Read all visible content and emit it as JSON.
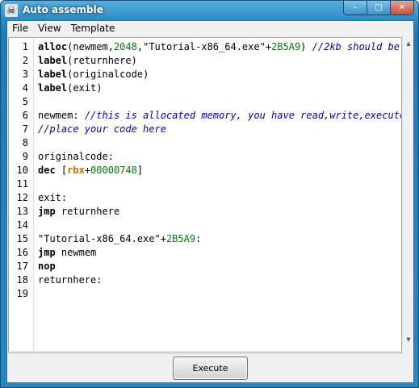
{
  "window": {
    "title": "Auto assemble",
    "icon_glyph": "☠",
    "caption_buttons": {
      "minimize": "–",
      "maximize": "□",
      "close": "✕"
    }
  },
  "menu": {
    "items": [
      {
        "label": "File"
      },
      {
        "label": "View"
      },
      {
        "label": "Template"
      }
    ]
  },
  "editor": {
    "line_numbers": [
      "1",
      "2",
      "3",
      "4",
      "5",
      "6",
      "7",
      "8",
      "9",
      "10",
      "11",
      "12",
      "13",
      "14",
      "15",
      "16",
      "17",
      "18",
      "19"
    ],
    "lines": [
      "alloc(newmem,2048,\"Tutorial-x86_64.exe\"+2B5A9) //2kb should be enough",
      "label(returnhere)",
      "label(originalcode)",
      "label(exit)",
      "",
      "newmem: //this is allocated memory, you have read,write,execute access",
      "//place your code here",
      "",
      "originalcode:",
      "dec [rbx+00000748]",
      "",
      "exit:",
      "jmp returnhere",
      "",
      "\"Tutorial-x86_64.exe\"+2B5A9:",
      "jmp newmem",
      "nop",
      "returnhere:",
      ""
    ],
    "colors": {
      "keyword": "#000000",
      "number": "#008000",
      "comment": "#0000c0",
      "register": "#c07000"
    }
  },
  "scrollbar": {
    "up_icon": "▲",
    "down_icon": "▼",
    "left_icon": "◀",
    "right_icon": "▶",
    "grip": "|||"
  },
  "footer": {
    "execute_label": "Execute"
  },
  "colors": {
    "title_bar": "#2b8ac4",
    "client_background": "#f0f0f0"
  }
}
